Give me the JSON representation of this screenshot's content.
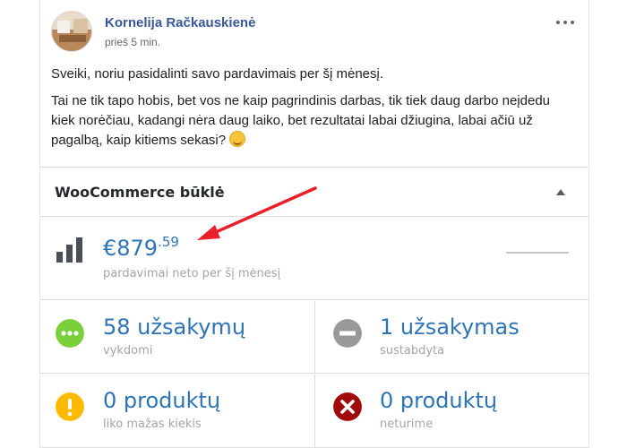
{
  "post": {
    "author": "Kornelija Račkauskienė",
    "time": "prieš 5 min.",
    "paragraph1": "Sveiki, noriu pasidalinti savo pardavimais per šį mėnesį.",
    "paragraph2": "Tai ne tik tapo hobis, bet vos ne kaip pagrindinis darbas, tik tiek daug darbo neįdedu kiek norėčiau, kadangi nėra daug laiko, bet rezultatai labai džiugina, labai ačiū už pagalbą, kaip kitiems sekasi?",
    "emoji": "hugging-face-emoji"
  },
  "widget": {
    "title": "WooCommerce būklė",
    "sales": {
      "amount_main": "€879",
      "amount_cents": ".59",
      "label": "pardavimai neto per šį mėnesį"
    },
    "stats": [
      {
        "count": "58 užsakymų",
        "label": "vykdomi",
        "icon": "processing-icon",
        "color": "#7ad03a"
      },
      {
        "count": "1 užsakymas",
        "label": "sustabdyta",
        "icon": "on-hold-icon",
        "color": "#999999"
      },
      {
        "count": "0 produktų",
        "label": "liko mažas kiekis",
        "icon": "warning-icon",
        "color": "#ffba00"
      },
      {
        "count": "0 produktų",
        "label": "neturime",
        "icon": "out-of-stock-icon",
        "color": "#a00a0a"
      }
    ]
  },
  "colors": {
    "link": "#385898",
    "stat_value": "#2e74b5",
    "arrow": "#e8202a"
  }
}
